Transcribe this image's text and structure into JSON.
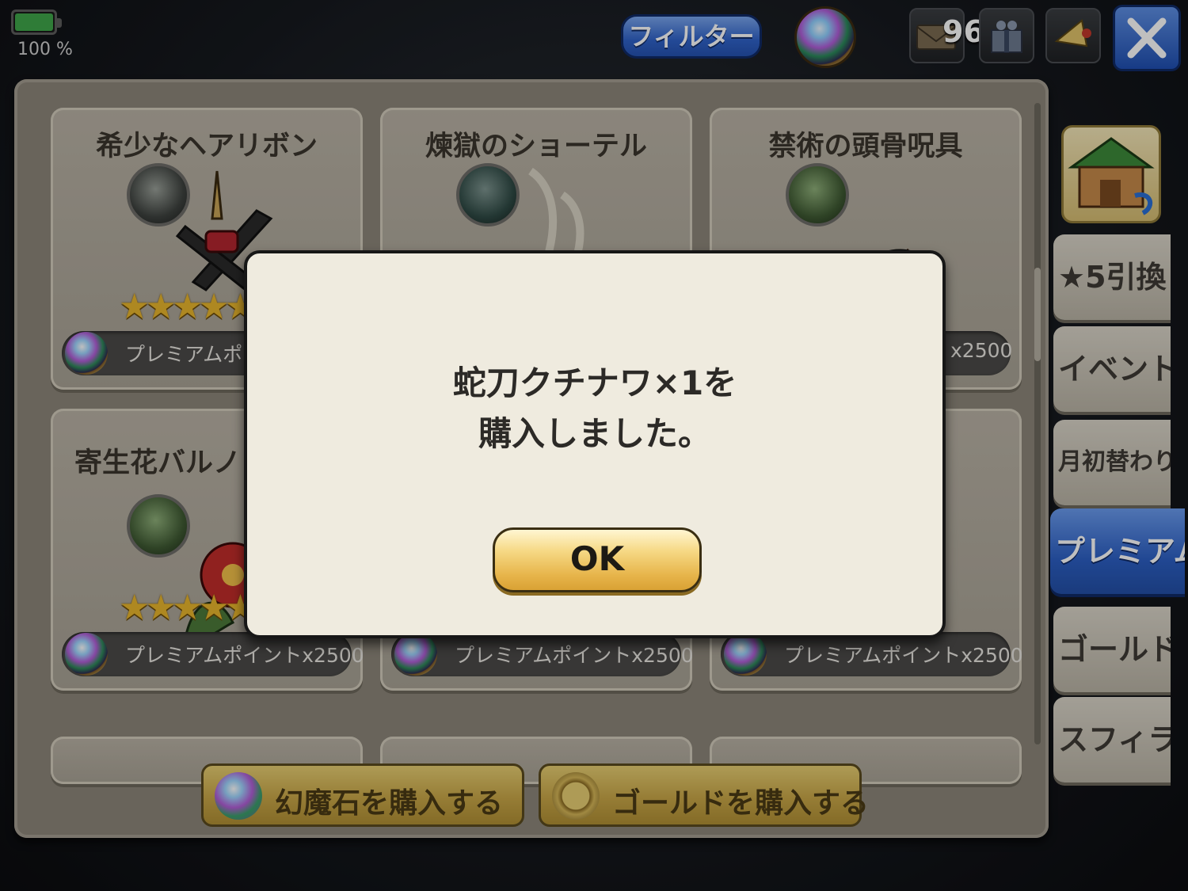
{
  "status": {
    "battery": "100 %"
  },
  "header": {
    "filter_label": "フィルター",
    "count": "960"
  },
  "shop": {
    "items": [
      {
        "name": "希少なヘアリボン",
        "stars": "★★★★★",
        "price": "プレミアムポイ"
      },
      {
        "name": "煉獄のショーテル",
        "stars": "",
        "price": ""
      },
      {
        "name": "禁術の頭骨呪具",
        "stars": "",
        "price": "x2500"
      },
      {
        "name": "寄生花バルノ",
        "stars": "★★★★★",
        "price": "プレミアムポイントx2500"
      },
      {
        "name": "",
        "stars": "★★★★★",
        "price": "プレミアムポイントx2500"
      },
      {
        "name": "",
        "stars": "★★★★★",
        "price": "プレミアムポイントx2500"
      }
    ],
    "buy_gem_label": "幻魔石を購入する",
    "buy_gold_label": "ゴールドを購入する"
  },
  "tabs": [
    "★5引換",
    "イベント",
    "月初替わり",
    "プレミアム",
    "ゴールド",
    "スフィラ"
  ],
  "active_tab": "プレミアム",
  "dialog": {
    "line1": "蛇刀クチナワ×1を",
    "line2": "購入しました。",
    "ok_label": "OK"
  }
}
